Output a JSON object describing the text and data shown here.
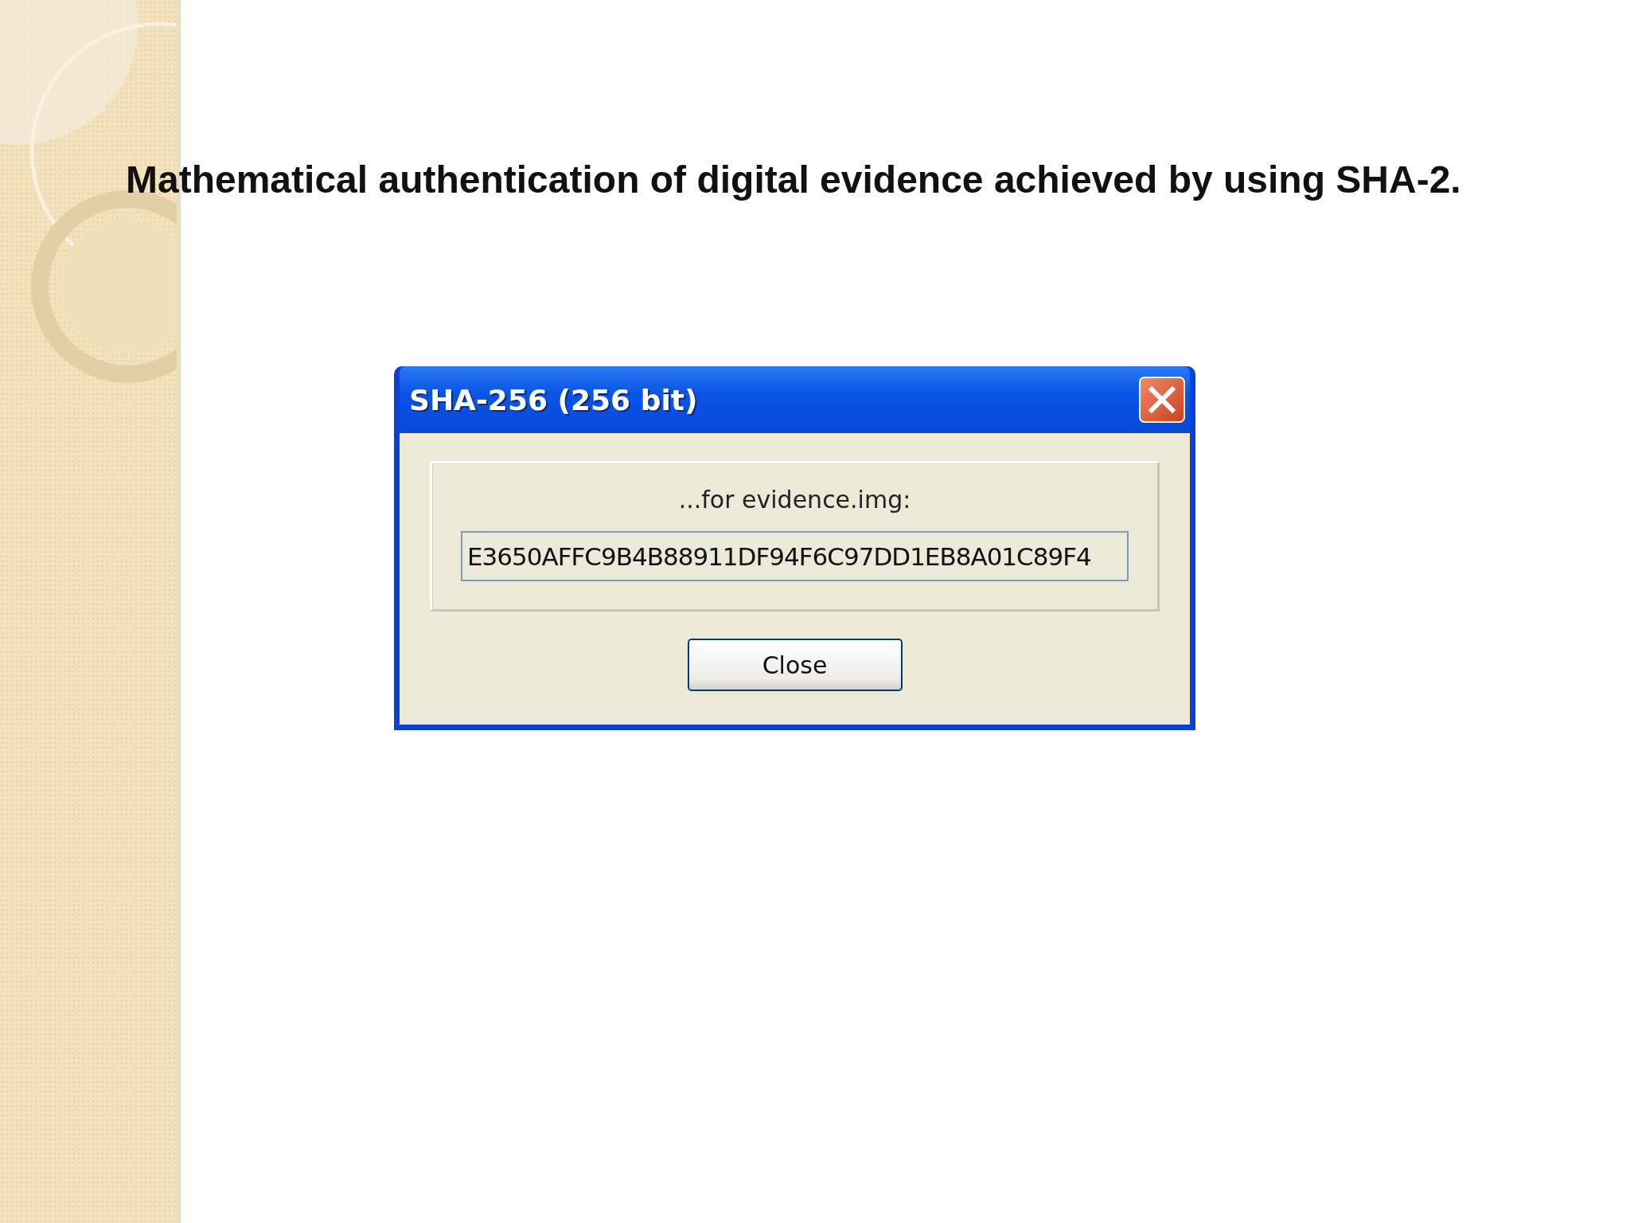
{
  "slide": {
    "title": "Mathematical authentication of digital evidence achieved by using SHA-2."
  },
  "dialog": {
    "title": "SHA-256 (256 bit)",
    "label": "...for evidence.img:",
    "hash_field": {
      "value": "E3650AFFC9B4B88911DF94F6C97DD1EB8A01C89F4"
    },
    "buttons": [
      "Close"
    ]
  }
}
